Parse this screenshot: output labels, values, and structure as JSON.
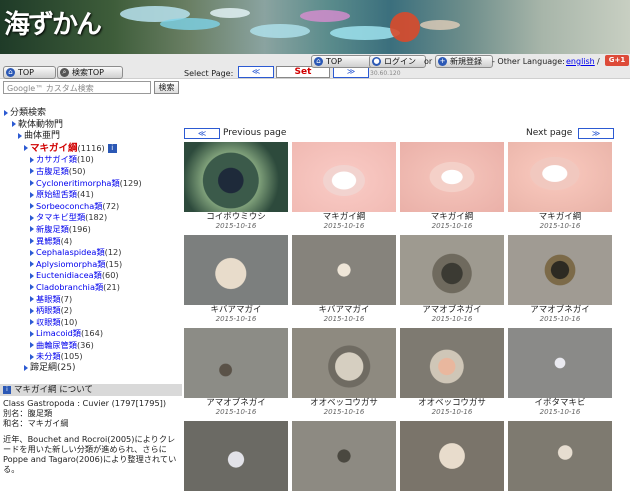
{
  "site": {
    "logo_text": "海ずかん"
  },
  "toolbar": {
    "top_left_label": "TOP",
    "search_top_label": "検索TOP",
    "select_page_label": "Select Page:",
    "prev_arrow": "≪",
    "set_label": "Set",
    "next_arrow": "≫",
    "top_label": "TOP",
    "login_label": "ログイン",
    "or_text": "or",
    "register_label": "新規登録",
    "other_language_text": "- Other Language:",
    "english_link": "english",
    "slash_text": "/",
    "gplus_label": "G+1",
    "page_sizes": "30.60.120"
  },
  "search": {
    "placeholder": "Google™ カスタム検索",
    "button_label": "検索"
  },
  "tree": {
    "root": "分類検索",
    "level1": "軟体動物門",
    "level2": "曲体亜門",
    "selected": {
      "label": "マキガイ綱",
      "count": "(1116)"
    },
    "children": [
      {
        "label": "カサガイ類",
        "count": "(10)"
      },
      {
        "label": "古腹足類",
        "count": "(50)"
      },
      {
        "label": "Cycloneritimorpha類",
        "count": "(129)"
      },
      {
        "label": "原始紐舌類",
        "count": "(41)"
      },
      {
        "label": "Sorbeoconcha類",
        "count": "(72)"
      },
      {
        "label": "タマキビ型類",
        "count": "(182)"
      },
      {
        "label": "新腹足類",
        "count": "(196)"
      },
      {
        "label": "異鰓類",
        "count": "(4)"
      },
      {
        "label": "Cephalaspidea類",
        "count": "(12)"
      },
      {
        "label": "Aplysiomorpha類",
        "count": "(15)"
      },
      {
        "label": "Euctenidiacea類",
        "count": "(60)"
      },
      {
        "label": "Cladobranchia類",
        "count": "(21)"
      },
      {
        "label": "基眼類",
        "count": "(7)"
      },
      {
        "label": "柄眼類",
        "count": "(2)"
      },
      {
        "label": "収眼類",
        "count": "(10)"
      },
      {
        "label": "Limacoid類",
        "count": "(164)"
      },
      {
        "label": "曲輪尿管類",
        "count": "(36)"
      },
      {
        "label": "未分類",
        "count": "(105)"
      }
    ],
    "sibling": {
      "label": "蹄足綱",
      "count": "(25)"
    }
  },
  "about": {
    "title": "マキガイ綱 について",
    "class_line": "Class Gastropoda : Cuvier (1797[1795])",
    "alias_line": "別名：腹足類",
    "jpname_line": "和名：マキガイ綱",
    "paragraph": "近年、Bouchet and Rocroi(2005)によりクレードを用いた新しい分類が進められ、さらにPoppe and Tagaro(2006)により整理されている。"
  },
  "pager": {
    "prev_label": "Previous page",
    "next_label": "Next page",
    "prev_arrow": "≪",
    "next_arrow": "≫"
  },
  "photos": [
    {
      "name": "コイボウミウシ",
      "date": "2015-10-16"
    },
    {
      "name": "マキガイ綱",
      "date": "2015-10-16"
    },
    {
      "name": "マキガイ綱",
      "date": "2015-10-16"
    },
    {
      "name": "マキガイ綱",
      "date": "2015-10-16"
    },
    {
      "name": "キバアマガイ",
      "date": "2015-10-16"
    },
    {
      "name": "キバアマガイ",
      "date": "2015-10-16"
    },
    {
      "name": "アマオブネガイ",
      "date": "2015-10-16"
    },
    {
      "name": "アマオブネガイ",
      "date": "2015-10-16"
    },
    {
      "name": "アマオブネガイ",
      "date": "2015-10-16"
    },
    {
      "name": "オオベッコウガサ",
      "date": "2015-10-16"
    },
    {
      "name": "オオベッコウガサ",
      "date": "2015-10-16"
    },
    {
      "name": "イボタマキビ",
      "date": "2015-10-16"
    },
    {
      "name": "",
      "date": ""
    },
    {
      "name": "",
      "date": ""
    },
    {
      "name": "",
      "date": ""
    },
    {
      "name": "",
      "date": ""
    }
  ],
  "colors": {
    "link": "#0000ee",
    "accent_blue": "#2c5ad2",
    "selected_red": "#d10000"
  }
}
